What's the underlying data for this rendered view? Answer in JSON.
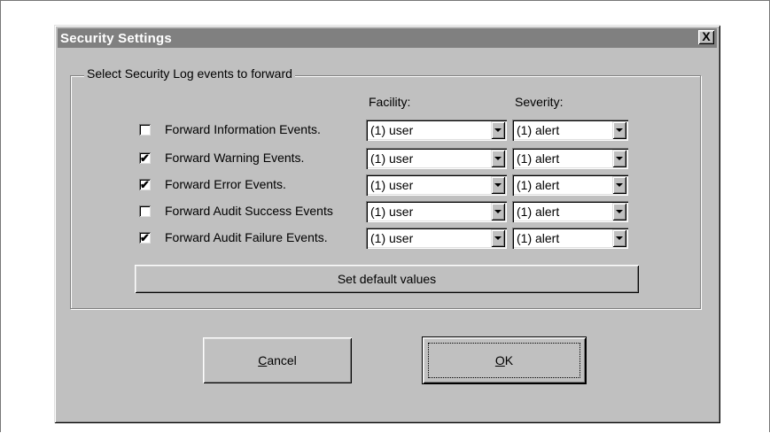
{
  "window": {
    "title": "Security Settings",
    "close_label": "X"
  },
  "group": {
    "legend": "Select Security Log events to forward"
  },
  "columns": {
    "facility": "Facility:",
    "severity": "Severity:"
  },
  "rows": [
    {
      "label": "Forward Information Events.",
      "checked": false,
      "facility": "(1) user",
      "severity": "(1) alert"
    },
    {
      "label": "Forward Warning Events.",
      "checked": true,
      "facility": "(1) user",
      "severity": "(1) alert"
    },
    {
      "label": "Forward Error Events.",
      "checked": true,
      "facility": "(1) user",
      "severity": "(1) alert"
    },
    {
      "label": "Forward Audit Success Events",
      "checked": false,
      "facility": "(1) user",
      "severity": "(1) alert"
    },
    {
      "label": "Forward Audit Failure Events.",
      "checked": true,
      "facility": "(1) user",
      "severity": "(1) alert"
    }
  ],
  "buttons": {
    "defaults": "Set default values",
    "cancel_first": "C",
    "cancel_rest": "ancel",
    "ok_first": "O",
    "ok_rest": "K"
  }
}
